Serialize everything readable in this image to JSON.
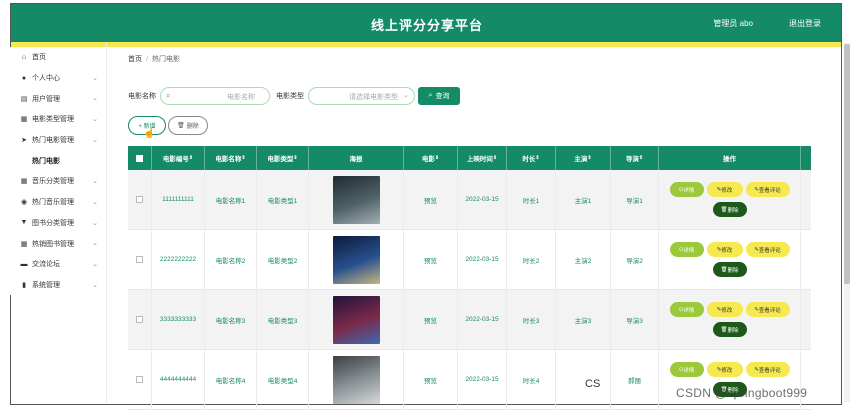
{
  "header": {
    "title": "线上评分分享平台",
    "admin": "管理员 abo",
    "logout": "退出登录"
  },
  "sidebar": {
    "items": [
      {
        "label": "首页",
        "icon": "home-icon",
        "glyph": "⌂",
        "chevron": false
      },
      {
        "label": "个人中心",
        "icon": "user-icon",
        "glyph": "●",
        "chevron": true
      },
      {
        "label": "用户管理",
        "icon": "users-icon",
        "glyph": "▤",
        "chevron": true
      },
      {
        "label": "电影类型管理",
        "icon": "grid-icon",
        "glyph": "▦",
        "chevron": true
      },
      {
        "label": "热门电影管理",
        "icon": "send-icon",
        "glyph": "➤",
        "chevron": true
      },
      {
        "label": "热门电影",
        "sub": true
      },
      {
        "label": "音乐分类管理",
        "icon": "grid-icon",
        "glyph": "▦",
        "chevron": true
      },
      {
        "label": "热门音乐管理",
        "icon": "location-icon",
        "glyph": "◉",
        "chevron": true
      },
      {
        "label": "图书分类管理",
        "icon": "filter-icon",
        "glyph": "▼",
        "chevron": true
      },
      {
        "label": "热销图书管理",
        "icon": "grid-icon",
        "glyph": "▦",
        "chevron": true
      },
      {
        "label": "交流论坛",
        "icon": "monitor-icon",
        "glyph": "▬",
        "chevron": true
      },
      {
        "label": "系统管理",
        "icon": "bar-chart-icon",
        "glyph": "▮",
        "chevron": true
      }
    ]
  },
  "breadcrumb": {
    "home": "首页",
    "separator": "/",
    "current": "热门电影"
  },
  "search": {
    "name_label": "电影名称",
    "name_placeholder": "电影名称",
    "type_label": "电影类型",
    "type_placeholder": "请选择电影类型",
    "search_button": "查询"
  },
  "actions": {
    "add": "+ 新增",
    "delete": "删除"
  },
  "table": {
    "columns": [
      "电影编号",
      "电影名称",
      "电影类型",
      "海报",
      "电影",
      "上映时间",
      "时长",
      "主演",
      "导演",
      "操作"
    ],
    "rows": [
      {
        "id": "1111111111",
        "name": "电影名称1",
        "type": "电影类型1",
        "video": "预览",
        "date": "2022-03-15",
        "duration": "时长1",
        "actor": "主演1",
        "director": "导演1",
        "poster": [
          "#1f2b30",
          "#4f6168",
          "#a3b0b2"
        ]
      },
      {
        "id": "2222222222",
        "name": "电影名称2",
        "type": "电影类型2",
        "video": "预览",
        "date": "2022-03-15",
        "duration": "时长2",
        "actor": "主演2",
        "director": "导演2",
        "poster": [
          "#0d1a3a",
          "#27508f",
          "#c8b680"
        ]
      },
      {
        "id": "3333333333",
        "name": "电影名称3",
        "type": "电影类型3",
        "video": "预览",
        "date": "2022-03-15",
        "duration": "时长3",
        "actor": "主演3",
        "director": "导演3",
        "poster": [
          "#22123a",
          "#7a2a4a",
          "#3e6ab0"
        ]
      },
      {
        "id": "4444444444",
        "name": "电影名称4",
        "type": "电影类型4",
        "video": "预览",
        "date": "2022-03-15",
        "duration": "时长4",
        "actor": "",
        "director": "郝丽",
        "poster": [
          "#3a3f42",
          "#8d969a",
          "#d7d9d8"
        ]
      }
    ],
    "ops": {
      "detail": "详情",
      "edit": "修改",
      "review": "查看评论",
      "delete": "删除"
    }
  },
  "overlay": {
    "cs_mark": "CS",
    "watermark": "CSDN @springboot999"
  },
  "colors": {
    "primary": "#148a66",
    "accent": "#f5e94f",
    "detail": "#9cc83c",
    "delete": "#1d5a1a"
  }
}
